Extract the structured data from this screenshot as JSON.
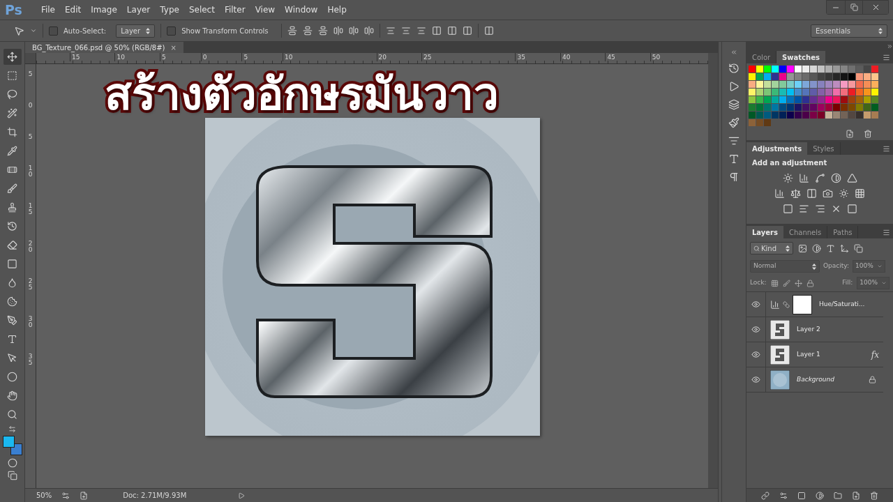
{
  "app": {
    "logo": "Ps"
  },
  "menu": [
    "File",
    "Edit",
    "Image",
    "Layer",
    "Type",
    "Select",
    "Filter",
    "View",
    "Window",
    "Help"
  ],
  "options_bar": {
    "auto_select": {
      "label": "Auto-Select:",
      "checked": false
    },
    "target": "Layer",
    "transform_controls": {
      "label": "Show Transform Controls",
      "checked": false
    },
    "workspace": "Essentials"
  },
  "document": {
    "tab": "BG_Texture_066.psd @ 50% (RGB/8#)",
    "close": "×",
    "ruler_h": [
      "15",
      "10",
      "5",
      "0",
      "5",
      "10",
      "20",
      "25",
      "35",
      "40",
      "45",
      "50"
    ],
    "ruler_v": [
      "5",
      "0",
      "5",
      "10",
      "15",
      "20",
      "25",
      "30",
      "35"
    ]
  },
  "overlay_title": "สร้างตัวอักษรมันวาว",
  "status_bar": {
    "zoom": "50%",
    "doc": "Doc: 2.71M/9.93M"
  },
  "swatches_panel": {
    "tabs": [
      {
        "label": "Color",
        "selected": false
      },
      {
        "label": "Swatches",
        "selected": true
      }
    ]
  },
  "adjustments_panel": {
    "tabs": [
      {
        "label": "Adjustments",
        "selected": true
      },
      {
        "label": "Styles",
        "selected": false
      }
    ],
    "heading": "Add an adjustment"
  },
  "layers_panel": {
    "tabs": [
      {
        "label": "Layers",
        "selected": true
      },
      {
        "label": "Channels",
        "selected": false
      },
      {
        "label": "Paths",
        "selected": false
      }
    ],
    "filter": "Kind",
    "fx_badge": "fx",
    "blend_mode": "Normal",
    "opacity_label": "Opacity:",
    "opacity": "100%",
    "lock_label": "Lock:",
    "fill_label": "Fill:",
    "fill": "100%",
    "disabled": true,
    "layers": [
      {
        "name": "Hue/Saturati...",
        "kind": "adjustment",
        "visible": true,
        "fx": false,
        "locked": false
      },
      {
        "name": "Layer 2",
        "kind": "pixel",
        "visible": true,
        "fx": false,
        "locked": false
      },
      {
        "name": "Layer 1",
        "kind": "pixel",
        "visible": true,
        "fx": true,
        "locked": false
      },
      {
        "name": "Background",
        "kind": "background",
        "visible": true,
        "fx": false,
        "locked": true
      }
    ]
  }
}
